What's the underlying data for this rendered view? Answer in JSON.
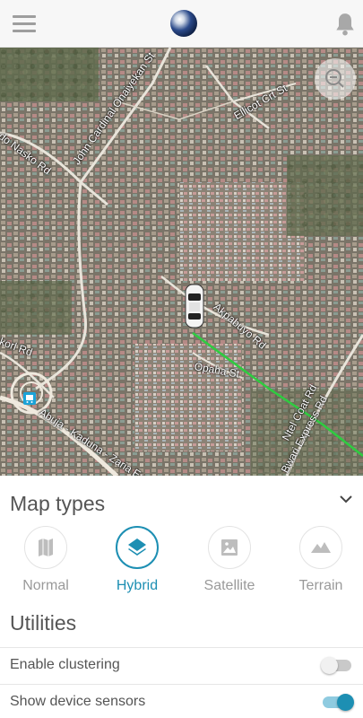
{
  "header": {
    "menu_icon": "hamburger-menu-icon",
    "logo_icon": "globe-logo",
    "notification_icon": "bell-icon"
  },
  "map": {
    "street_labels": [
      "John Cardinal Onaiyekan St",
      "Ellicot Crt St",
      "do Nasko Rd",
      "Akpabuyo Rd",
      "Opaha St",
      "korl Rd",
      "Abuja - Kaduna - Zaria Expy",
      "Ntel Coat Rd",
      "Bwari Express Rd"
    ],
    "vehicle_icon": "car-marker-icon",
    "transit_icon": "bus-stop-icon",
    "zoom_icon": "zoom-out-icon",
    "route_color": "#2ecc40"
  },
  "map_types": {
    "title": "Map types",
    "options": [
      {
        "label": "Normal",
        "icon": "map-icon",
        "active": false
      },
      {
        "label": "Hybrid",
        "icon": "layers-icon",
        "active": true
      },
      {
        "label": "Satellite",
        "icon": "image-icon",
        "active": false
      },
      {
        "label": "Terrain",
        "icon": "terrain-icon",
        "active": false
      }
    ],
    "accent_color": "#1d8fb3"
  },
  "utilities": {
    "title": "Utilities",
    "items": [
      {
        "label": "Enable clustering",
        "enabled": false
      },
      {
        "label": "Show device sensors",
        "enabled": true
      }
    ]
  }
}
